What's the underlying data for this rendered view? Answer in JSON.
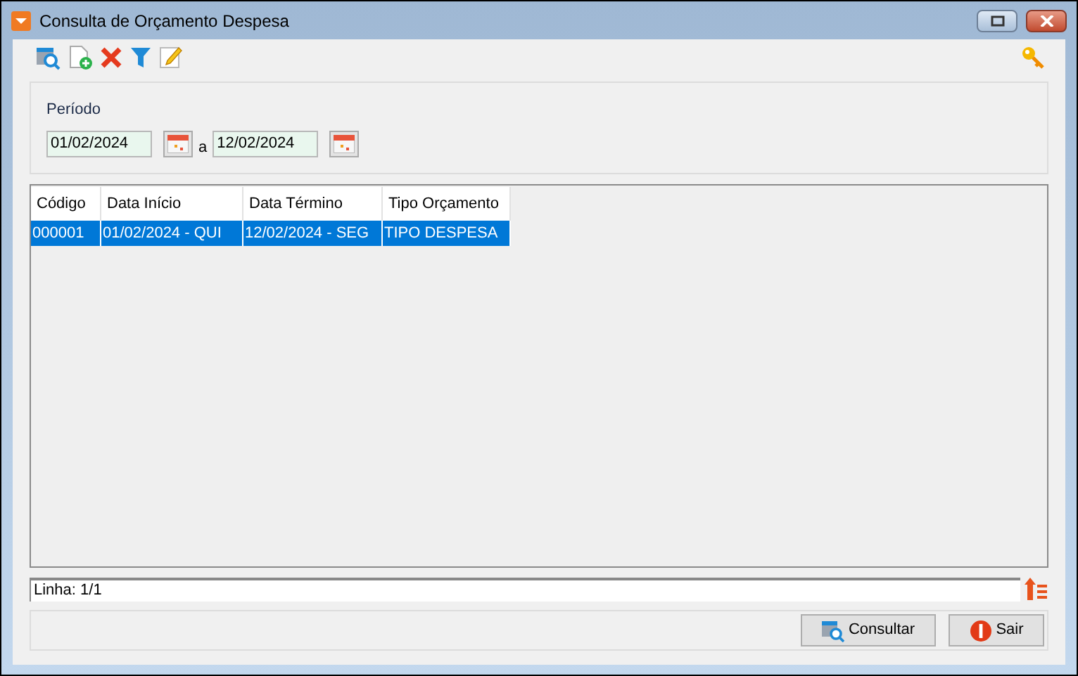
{
  "window": {
    "title": "Consulta de Orçamento Despesa"
  },
  "filter": {
    "label": "Período",
    "date_from": "01/02/2024",
    "separator": "a",
    "date_to": "12/02/2024"
  },
  "table": {
    "columns": [
      "Código",
      "Data Início",
      "Data Término",
      "Tipo Orçamento"
    ],
    "rows": [
      {
        "cells": [
          "000001",
          "01/02/2024 - QUI",
          "12/02/2024 - SEG",
          "TIPO DESPESA"
        ],
        "selected": true
      }
    ]
  },
  "status_bar": {
    "text": "Linha: 1/1"
  },
  "buttons": [
    {
      "label": "Consultar",
      "kind": "search"
    },
    {
      "label": "Sair",
      "kind": "exit"
    }
  ]
}
